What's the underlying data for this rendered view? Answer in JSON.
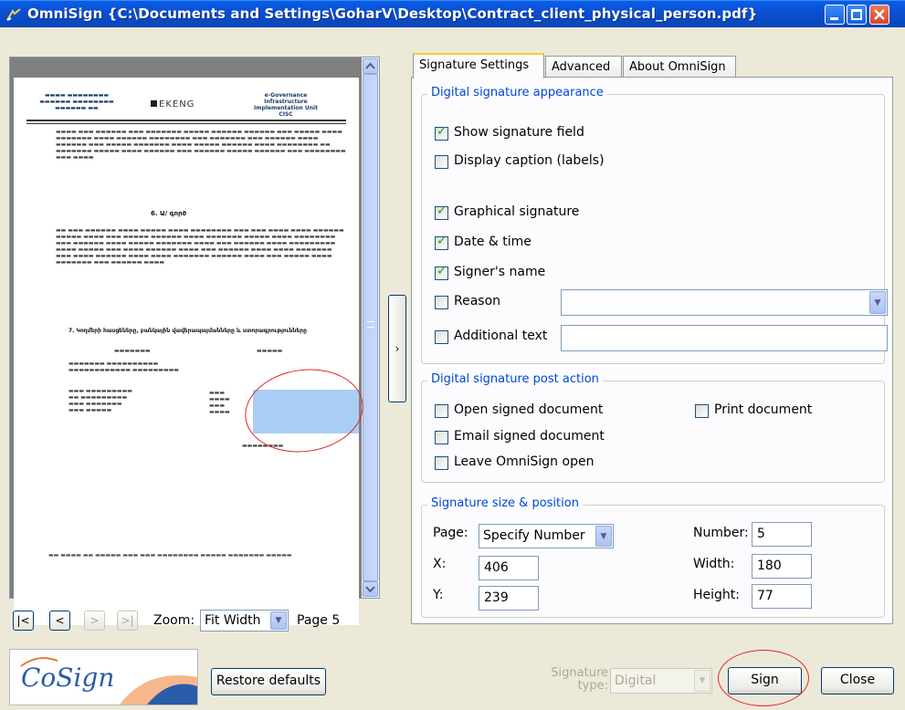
{
  "window": {
    "title": "OmniSign {C:\\Documents and Settings\\GoharV\\Desktop\\Contract_client_physical_person.pdf}"
  },
  "preview": {
    "zoom_label": "Zoom:",
    "zoom_value": "Fit Width",
    "page_label": "Page 5",
    "doc_heading": "6. Ա/ գործ",
    "doc_section": "7. Կողմերի հասցեները, բանկային վավերապայմանները և ստորագրությունները",
    "logo_text": "EKENG",
    "doc_header_right": "e-Governance Infrastructure Implementation Unit CJSC"
  },
  "tabs": [
    {
      "label": "Signature Settings"
    },
    {
      "label": "Advanced"
    },
    {
      "label": "About OmniSign"
    }
  ],
  "appearance": {
    "legend": "Digital signature appearance",
    "show_field": "Show signature field",
    "display_caption": "Display caption (labels)",
    "graphical": "Graphical signature",
    "datetime": "Date & time",
    "signer": "Signer's name",
    "reason": "Reason",
    "additional": "Additional text"
  },
  "post_action": {
    "legend": "Digital signature post action",
    "open_doc": "Open signed document",
    "print_doc": "Print document",
    "email_doc": "Email signed document",
    "leave_open": "Leave OmniSign open"
  },
  "size_pos": {
    "legend": "Signature size & position",
    "page_label": "Page:",
    "page_value": "Specify Number",
    "number_label": "Number:",
    "number_value": "5",
    "x_label": "X:",
    "x_value": "406",
    "width_label": "Width:",
    "width_value": "180",
    "y_label": "Y:",
    "y_value": "239",
    "height_label": "Height:",
    "height_value": "77"
  },
  "bottom": {
    "logo": "CoSign",
    "restore": "Restore defaults",
    "sigtype_label1": "Signature",
    "sigtype_label2": "type:",
    "sigtype_value": "Digital",
    "sign": "Sign",
    "close": "Close"
  },
  "colors": {
    "titlebar": "#0b4fd3",
    "legend": "#0046d5",
    "highlight": "#e0262e",
    "signature_box": "#a9cdf5"
  }
}
